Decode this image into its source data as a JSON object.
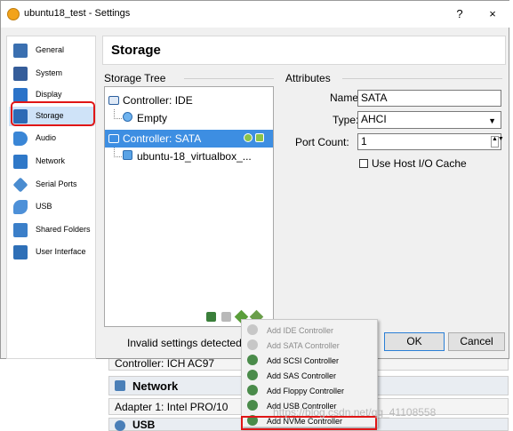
{
  "window": {
    "title": "ubuntu18_test - Settings",
    "help": "?",
    "close": "×"
  },
  "sidebar": {
    "items": [
      {
        "label": "General",
        "icon": "general-icon",
        "color": "#3a6fb0"
      },
      {
        "label": "System",
        "icon": "system-icon",
        "color": "#355d9a"
      },
      {
        "label": "Display",
        "icon": "display-icon",
        "color": "#2b73c9"
      },
      {
        "label": "Storage",
        "icon": "storage-icon",
        "color": "#2d6ab5"
      },
      {
        "label": "Audio",
        "icon": "audio-icon",
        "color": "#3a86d6"
      },
      {
        "label": "Network",
        "icon": "network-icon",
        "color": "#2f78c8"
      },
      {
        "label": "Serial Ports",
        "icon": "serial-ports-icon",
        "color": "#4a8cd0"
      },
      {
        "label": "USB",
        "icon": "usb-icon",
        "color": "#4d90d8"
      },
      {
        "label": "Shared Folders",
        "icon": "shared-folders-icon",
        "color": "#3b7fc9"
      },
      {
        "label": "User Interface",
        "icon": "user-interface-icon",
        "color": "#2e6fb7"
      }
    ],
    "selected": "Storage"
  },
  "page": {
    "title": "Storage"
  },
  "storage_tree": {
    "heading": "Storage Tree",
    "rows": [
      {
        "label": "Controller: IDE"
      },
      {
        "label": "Empty"
      },
      {
        "label": "Controller: SATA"
      },
      {
        "label": "ubuntu-18_virtualbox_..."
      }
    ]
  },
  "attributes": {
    "heading": "Attributes",
    "name_label": "Name:",
    "name_value": "SATA",
    "type_label": "Type:",
    "type_value": "AHCI",
    "port_label": "Port Count:",
    "port_value": "1",
    "cache_label": "Use Host I/O Cache"
  },
  "footer": {
    "status": "Invalid settings detected",
    "ok": "OK",
    "cancel": "Cancel"
  },
  "context_menu": {
    "items": [
      {
        "label": "Add IDE Controller",
        "enabled": false
      },
      {
        "label": "Add SATA Controller",
        "enabled": false
      },
      {
        "label": "Add SCSI Controller",
        "enabled": true
      },
      {
        "label": "Add SAS Controller",
        "enabled": true
      },
      {
        "label": "Add Floppy Controller",
        "enabled": true
      },
      {
        "label": "Add USB Controller",
        "enabled": true
      },
      {
        "label": "Add NVMe Controller",
        "enabled": true
      }
    ]
  },
  "background": {
    "controller_row": "Controller:   ICH AC97",
    "network_heading": "Network",
    "adapter_row": "Adapter 1:  Intel PRO/10",
    "usb_heading": "USB"
  },
  "watermark": "https://blog.csdn.net/qq_41108558"
}
